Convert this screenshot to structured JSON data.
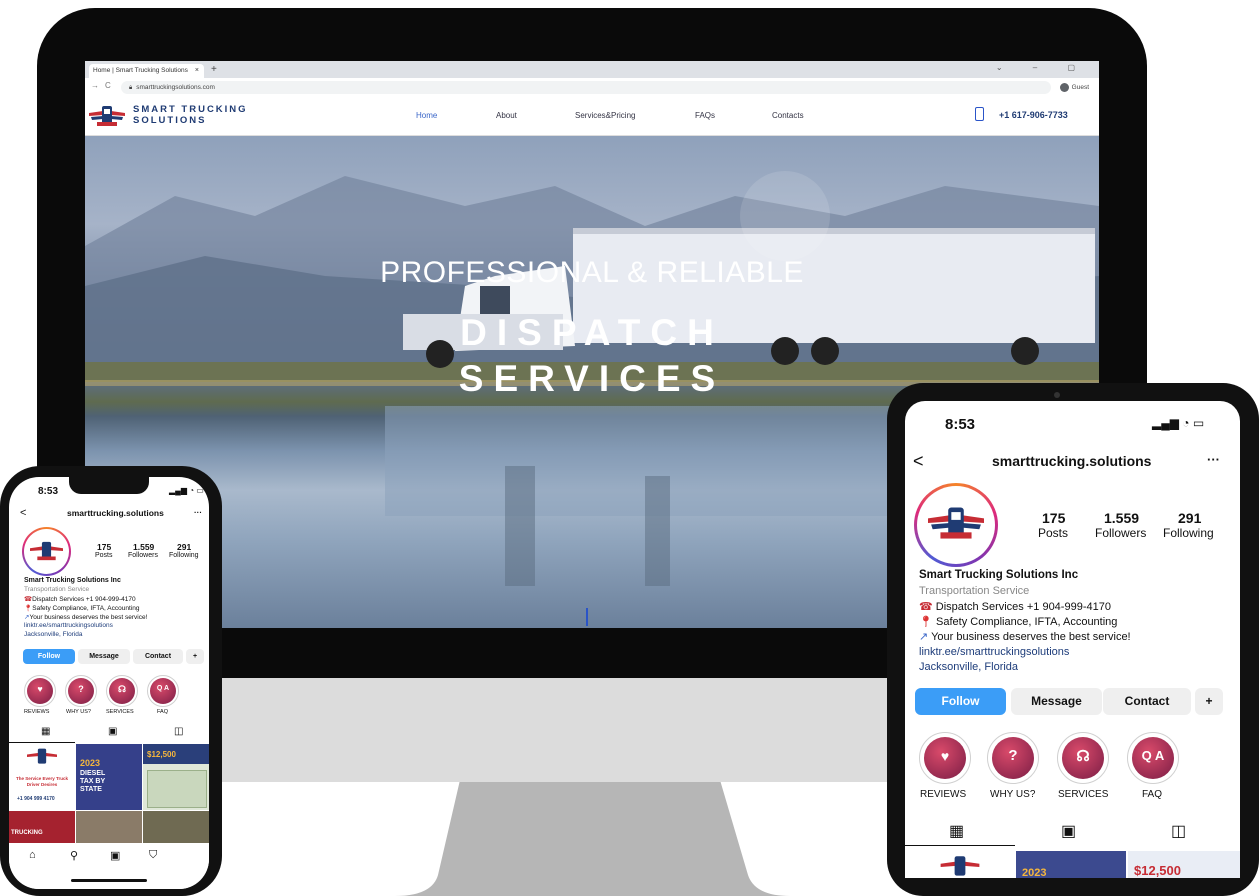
{
  "browser": {
    "tab_title": "Home | Smart Trucking Solutions",
    "tab_close": "×",
    "new_tab": "+",
    "window_controls": "⌄ – ▢",
    "back": "→",
    "reload": "C",
    "url": "smarttruckingsolutions.com",
    "profile": "Guest"
  },
  "site": {
    "logo_line1": "SMART TRUCKING",
    "logo_line2": "SOLUTIONS",
    "nav": [
      "Home",
      "About",
      "Services&Pricing",
      "FAQs",
      "Contacts"
    ],
    "phone": "+1 617-906-7733",
    "hero_subtitle": "PROFESSIONAL & RELIABLE",
    "hero_title_line1": "DISPATCH",
    "hero_title_line2": "SERVICES"
  },
  "instagram": {
    "time": "8:53",
    "username": "smarttrucking.solutions",
    "more": "···",
    "back": "<",
    "posts_count": "175",
    "posts_label": "Posts",
    "followers_count": "1.559",
    "followers_label": "Followers",
    "following_count": "291",
    "following_label": "Following",
    "name": "Smart Trucking Solutions Inc",
    "category": "Transportation Service",
    "bio1": "Dispatch Services +1 904-999-4170",
    "bio2": "Safety Compliance, IFTA, Accounting",
    "bio3": "Your business deserves the best service!",
    "link": "linktr.ee/smarttruckingsolutions",
    "location": "Jacksonville, Florida",
    "follow": "Follow",
    "message": "Message",
    "contact": "Contact",
    "add_person": "+",
    "highlights": [
      "REVIEWS",
      "WHY US?",
      "SERVICES",
      "FAQ"
    ],
    "post1_text": "The Service Every Truck Driver Desires",
    "post1_phone": "+1 904 999 4170",
    "post2_year": "2023",
    "post2_title": "DIESEL TAX BY STATE",
    "post3_amount": "$12,500",
    "post4_text": "TRUCKING"
  },
  "colors": {
    "brand_navy": "#1f3b73",
    "accent_blue": "#3b9df7",
    "link_blue": "#3a66c8"
  }
}
